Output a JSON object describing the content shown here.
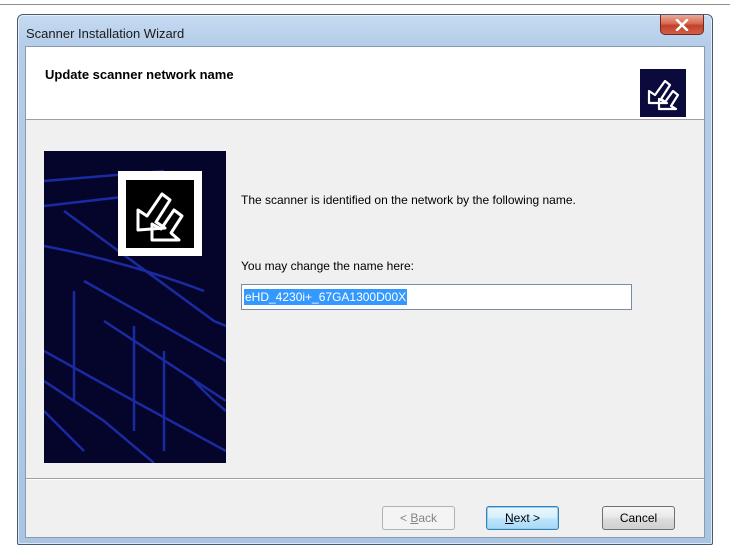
{
  "window": {
    "title": "Scanner Installation Wizard",
    "close_icon": "close-x-icon"
  },
  "header": {
    "title": "Update scanner network name",
    "icon": "scanner-arrows-icon"
  },
  "content": {
    "description": "The scanner is identified on the network by the following name.",
    "change_label": "You may change the name here:",
    "name_value": "eHD_4230i+_67GA1300D00X"
  },
  "buttons": {
    "back": {
      "accel": "B",
      "rest": "ack",
      "prefix": "< "
    },
    "next": {
      "accel": "N",
      "rest": "ext >"
    },
    "cancel": "Cancel"
  },
  "colors": {
    "side_panel": "#05052b",
    "selection": "#3399ff",
    "close_button": "#c2402a"
  }
}
